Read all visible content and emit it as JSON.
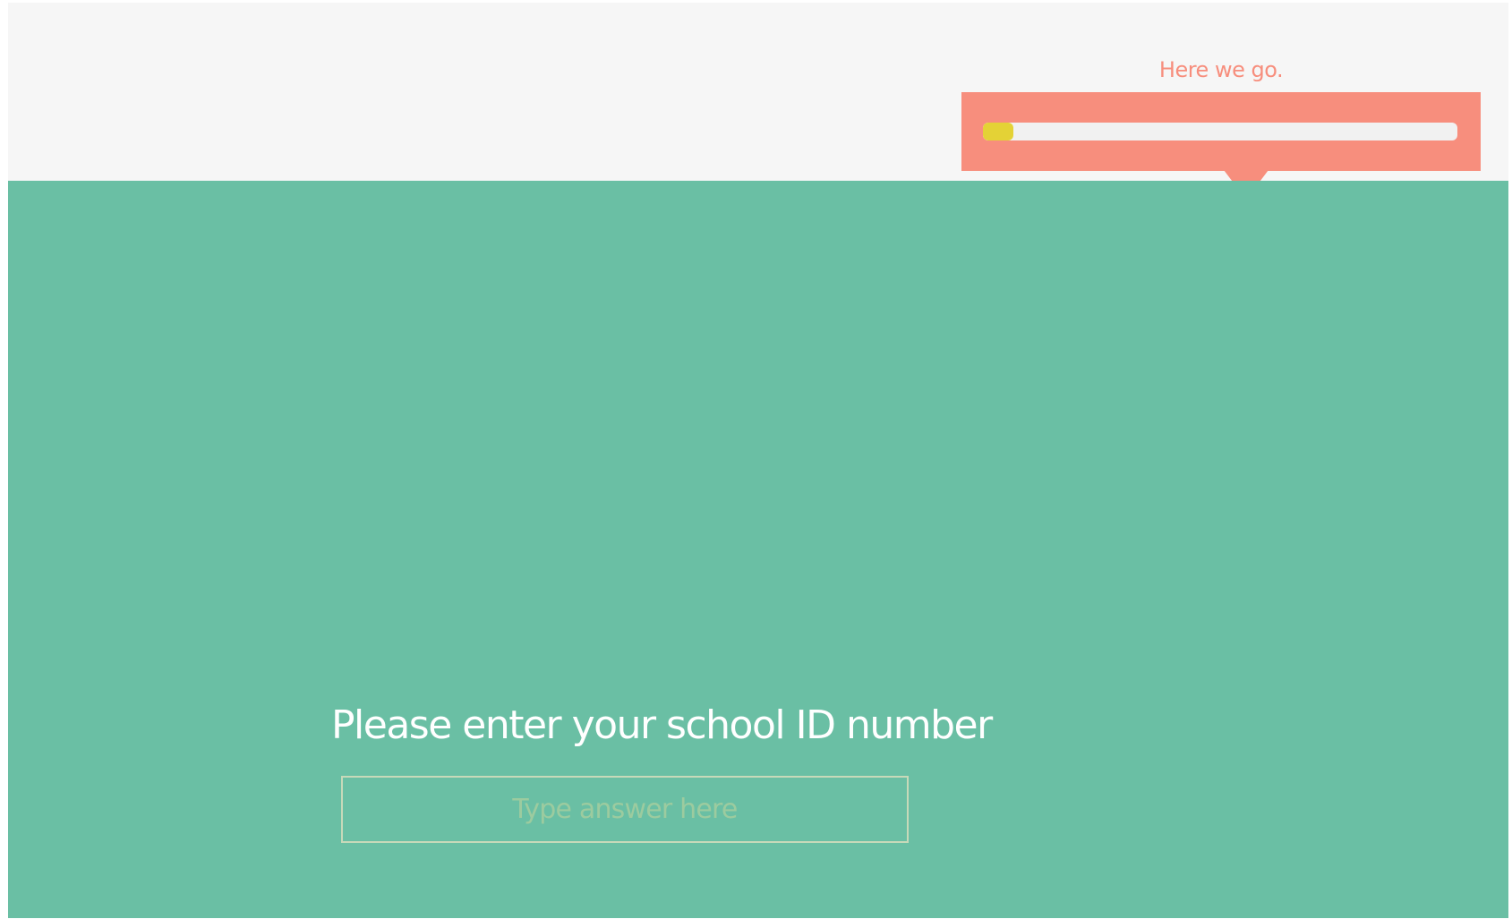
{
  "header": {
    "progress": {
      "caption": "Here we go.",
      "fraction": 0.065
    }
  },
  "question": {
    "text": "Please enter your school ID number",
    "answer_value": "",
    "answer_placeholder": "Type answer here"
  },
  "colors": {
    "header_background": "#f6f6f6",
    "main_background": "#6abfa4",
    "progress_panel": "#f78e7d",
    "progress_track": "#f1f1f1",
    "progress_fill": "#e4d236",
    "question_text": "#ffffff",
    "input_border": "#c7d9b9",
    "placeholder_text": "#9ccb9f"
  }
}
